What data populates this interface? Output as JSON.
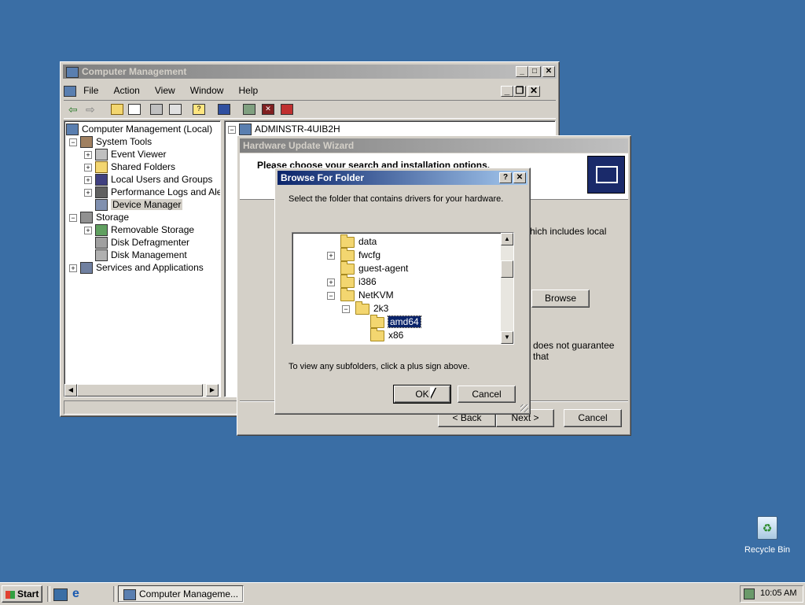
{
  "desktop": {
    "recycle_bin_label": "Recycle Bin"
  },
  "computer_management": {
    "title": "Computer Management",
    "menu": [
      "File",
      "Action",
      "View",
      "Window",
      "Help"
    ],
    "tree": {
      "root": "Computer Management (Local)",
      "system_tools": "System Tools",
      "event_viewer": "Event Viewer",
      "shared_folders": "Shared Folders",
      "local_users": "Local Users and Groups",
      "perf_logs": "Performance Logs and Alerts",
      "device_manager": "Device Manager",
      "storage": "Storage",
      "removable_storage": "Removable Storage",
      "disk_defrag": "Disk Defragmenter",
      "disk_mgmt": "Disk Management",
      "services_apps": "Services and Applications"
    },
    "right_root": "ADMINSTR-4UIB2H"
  },
  "wizard": {
    "title": "Hardware Update Wizard",
    "heading": "Please choose your search and installation options.",
    "text_partial_1": "hich includes local",
    "text_partial_2": "does not guarantee that",
    "browse_label": "Browse",
    "back_label": "< Back",
    "next_label": "Next >",
    "cancel_label": "Cancel"
  },
  "browse_dialog": {
    "title": "Browse For Folder",
    "instruction": "Select the folder that contains drivers for your hardware.",
    "folders": [
      {
        "name": "data",
        "level": 1,
        "expander": "none"
      },
      {
        "name": "fwcfg",
        "level": 1,
        "expander": "+"
      },
      {
        "name": "guest-agent",
        "level": 1,
        "expander": "none"
      },
      {
        "name": "i386",
        "level": 1,
        "expander": "+"
      },
      {
        "name": "NetKVM",
        "level": 1,
        "expander": "-"
      },
      {
        "name": "2k3",
        "level": 2,
        "expander": "-"
      },
      {
        "name": "amd64",
        "level": 3,
        "expander": "none",
        "selected": true
      },
      {
        "name": "x86",
        "level": 3,
        "expander": "none"
      }
    ],
    "hint": "To view any subfolders, click a plus sign above.",
    "ok_label": "OK",
    "cancel_label": "Cancel",
    "help_glyph": "?",
    "close_glyph": "✕"
  },
  "taskbar": {
    "start_label": "Start",
    "task_label": "Computer Manageme...",
    "clock": "10:05 AM"
  }
}
